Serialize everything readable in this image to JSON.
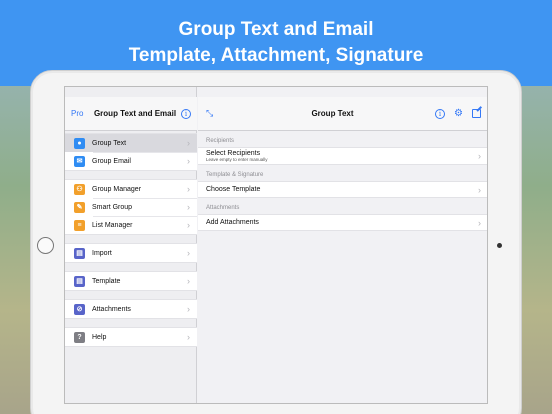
{
  "banner": {
    "line1": "Group Text and Email",
    "line2": "Template, Attachment, Signature"
  },
  "sidebar": {
    "pro_label": "Pro",
    "title": "Group Text and Email",
    "groups": [
      [
        {
          "label": "Group Text",
          "icon": "message-icon",
          "color": "#2f8cf3",
          "selected": true
        },
        {
          "label": "Group Email",
          "icon": "mail-icon",
          "color": "#2f8cf3",
          "selected": false
        }
      ],
      [
        {
          "label": "Group Manager",
          "icon": "people-icon",
          "color": "#f2a02b",
          "selected": false
        },
        {
          "label": "Smart Group",
          "icon": "smart-icon",
          "color": "#f2a02b",
          "selected": false
        },
        {
          "label": "List Manager",
          "icon": "list-icon",
          "color": "#f2a02b",
          "selected": false
        }
      ],
      [
        {
          "label": "Import",
          "icon": "import-icon",
          "color": "#5864c9",
          "selected": false
        }
      ],
      [
        {
          "label": "Template",
          "icon": "template-icon",
          "color": "#5864c9",
          "selected": false
        }
      ],
      [
        {
          "label": "Attachments",
          "icon": "paperclip-icon",
          "color": "#5864c9",
          "selected": false
        }
      ],
      [
        {
          "label": "Help",
          "icon": "question-icon",
          "color": "#7e7e84",
          "selected": false
        }
      ]
    ]
  },
  "detail": {
    "title": "Group Text",
    "sections": [
      {
        "header": "Recipients",
        "cell_label": "Select Recipients",
        "cell_sub": "Leave empty to enter manually"
      },
      {
        "header": "Template & Signature",
        "cell_label": "Choose Template",
        "cell_sub": ""
      },
      {
        "header": "Attachments",
        "cell_label": "Add Attachments",
        "cell_sub": ""
      }
    ]
  },
  "colors": {
    "accent": "#3478f6",
    "banner": "#3f95f2"
  }
}
